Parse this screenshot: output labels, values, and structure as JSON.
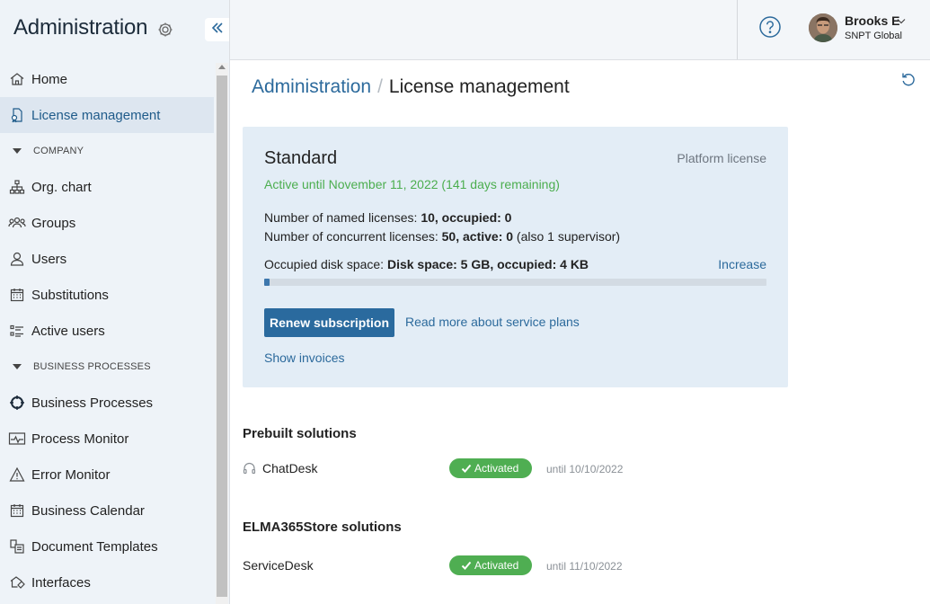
{
  "sidebar": {
    "title": "Administration",
    "items": [
      {
        "label": "Home",
        "icon": "home-icon"
      },
      {
        "label": "License management",
        "icon": "license-icon"
      },
      {
        "section": "COMPANY"
      },
      {
        "label": "Org. chart",
        "icon": "org-chart-icon"
      },
      {
        "label": "Groups",
        "icon": "groups-icon"
      },
      {
        "label": "Users",
        "icon": "user-icon"
      },
      {
        "label": "Substitutions",
        "icon": "calendar-icon"
      },
      {
        "label": "Active users",
        "icon": "active-users-icon"
      },
      {
        "section": "BUSINESS PROCESSES"
      },
      {
        "label": "Business Processes",
        "icon": "process-icon"
      },
      {
        "label": "Process Monitor",
        "icon": "monitor-icon"
      },
      {
        "label": "Error Monitor",
        "icon": "warning-icon"
      },
      {
        "label": "Business Calendar",
        "icon": "calendar-icon"
      },
      {
        "label": "Document Templates",
        "icon": "document-template-icon"
      },
      {
        "label": "Interfaces",
        "icon": "interfaces-icon"
      }
    ]
  },
  "user": {
    "name": "Brooks E",
    "org": "SNPT Global"
  },
  "breadcrumb": {
    "parent": "Administration",
    "separator": "/",
    "current": "License management"
  },
  "license": {
    "plan": "Standard",
    "type": "Platform license",
    "active_text": "Active until November 11, 2022 (141 days remaining)",
    "named_prefix": "Number of named licenses: ",
    "named_value": "10, occupied: 0",
    "concurrent_prefix": "Number of concurrent licenses: ",
    "concurrent_value": "50, active: 0",
    "concurrent_suffix": " (also 1 supervisor)",
    "disk_prefix": "Occupied disk space: ",
    "disk_value": "Disk space: 5 GB, occupied: 4 KB",
    "increase_label": "Increase",
    "disk_usage_fraction": 0.01,
    "renew_label": "Renew subscription",
    "read_more_label": "Read more about service plans",
    "invoices_label": "Show invoices"
  },
  "prebuilt": {
    "title": "Prebuilt solutions",
    "items": [
      {
        "name": "ChatDesk",
        "icon": "headset-icon",
        "status": "Activated",
        "until": "until 10/10/2022"
      }
    ]
  },
  "store": {
    "title": "ELMA365Store solutions",
    "items": [
      {
        "name": "ServiceDesk",
        "status": "Activated",
        "until": "until 11/10/2022"
      }
    ]
  },
  "colors": {
    "accent": "#2a6a9e",
    "success": "#4fae52",
    "link": "#2c6a9c",
    "card_bg": "#e3edf6"
  }
}
